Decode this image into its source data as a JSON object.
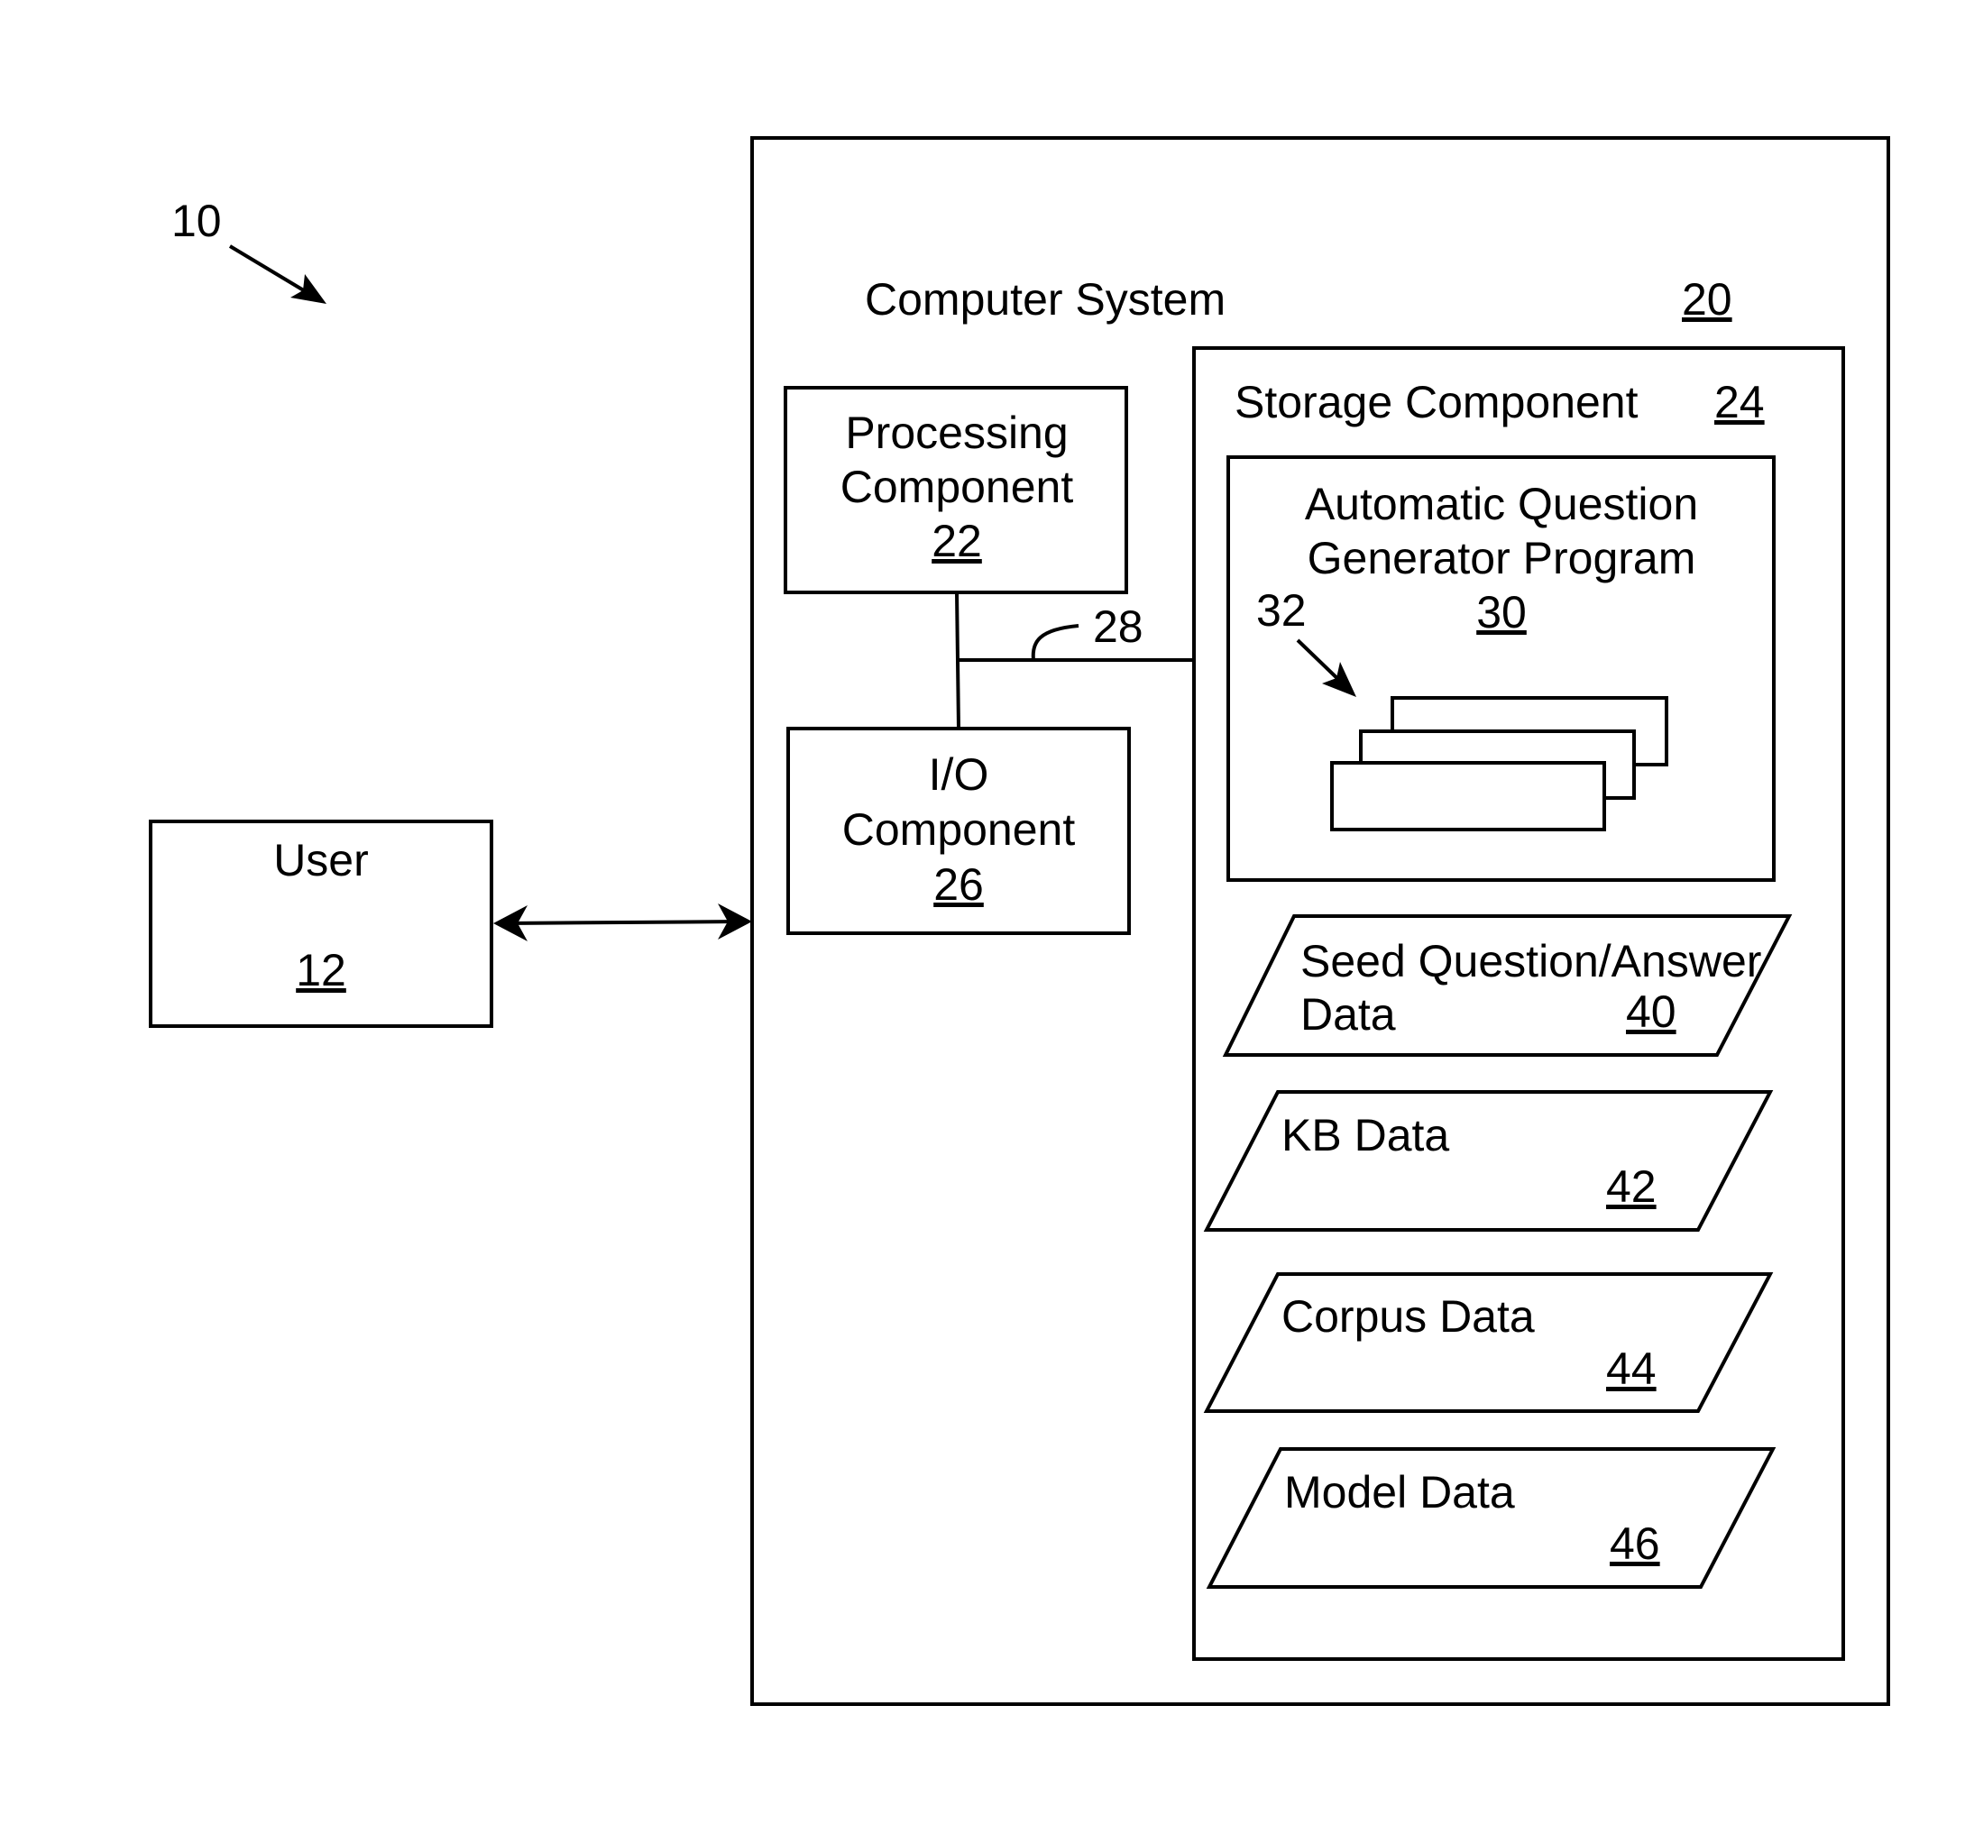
{
  "figure": {
    "system_ref": "10",
    "user": {
      "label": "User",
      "ref": "12"
    },
    "computer_system": {
      "label": "Computer System",
      "ref": "20"
    },
    "processing": {
      "line1": "Processing",
      "line2": "Component",
      "ref": "22"
    },
    "io": {
      "line1": "I/O",
      "line2": "Component",
      "ref": "26"
    },
    "bus_ref": "28",
    "storage": {
      "label": "Storage Component",
      "ref": "24"
    },
    "program": {
      "line1": "Automatic Question",
      "line2": "Generator Program",
      "ref": "30",
      "modules_ref": "32"
    },
    "data_stores": [
      {
        "line1": "Seed Question/Answer",
        "line2": "Data",
        "ref": "40"
      },
      {
        "line1": "KB Data",
        "line2": "",
        "ref": "42"
      },
      {
        "line1": "Corpus Data",
        "line2": "",
        "ref": "44"
      },
      {
        "line1": "Model Data",
        "line2": "",
        "ref": "46"
      }
    ]
  }
}
